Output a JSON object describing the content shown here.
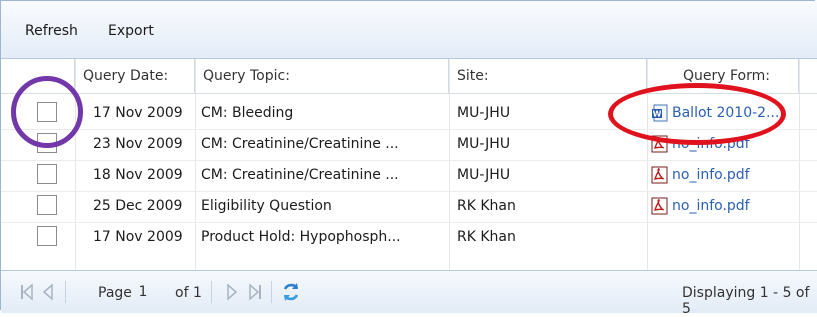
{
  "toolbar": {
    "refresh_label": "Refresh",
    "export_label": "Export"
  },
  "columns": {
    "date": "Query Date:",
    "topic": "Query Topic:",
    "site": "Site:",
    "form": "Query Form:"
  },
  "rows": [
    {
      "date": "17 Nov 2009",
      "topic": "CM: Bleeding",
      "site": "MU-JHU",
      "form": "Ballot 2010-2...",
      "form_icon": "word-doc-icon"
    },
    {
      "date": "23 Nov 2009",
      "topic": "CM: Creatinine/Creatinine ...",
      "site": "MU-JHU",
      "form": "no_info.pdf",
      "form_icon": "pdf-icon"
    },
    {
      "date": "18 Nov 2009",
      "topic": "CM: Creatinine/Creatinine ...",
      "site": "MU-JHU",
      "form": "no_info.pdf",
      "form_icon": "pdf-icon"
    },
    {
      "date": "25 Dec 2009",
      "topic": "Eligibility Question",
      "site": "RK Khan",
      "form": "no_info.pdf",
      "form_icon": "pdf-icon"
    },
    {
      "date": "17 Nov 2009",
      "topic": "Product Hold: Hypophosph...",
      "site": "RK Khan",
      "form": "",
      "form_icon": ""
    }
  ],
  "pager": {
    "page_label": "Page",
    "page_value": "1",
    "of_label": "of 1",
    "display_text": "Displaying 1 - 5 of 5"
  },
  "colors": {
    "header_bg": "#e3ecf7",
    "link": "#2a5fb4",
    "annotation_purple": "#7237a9",
    "annotation_red": "#e0121d"
  }
}
